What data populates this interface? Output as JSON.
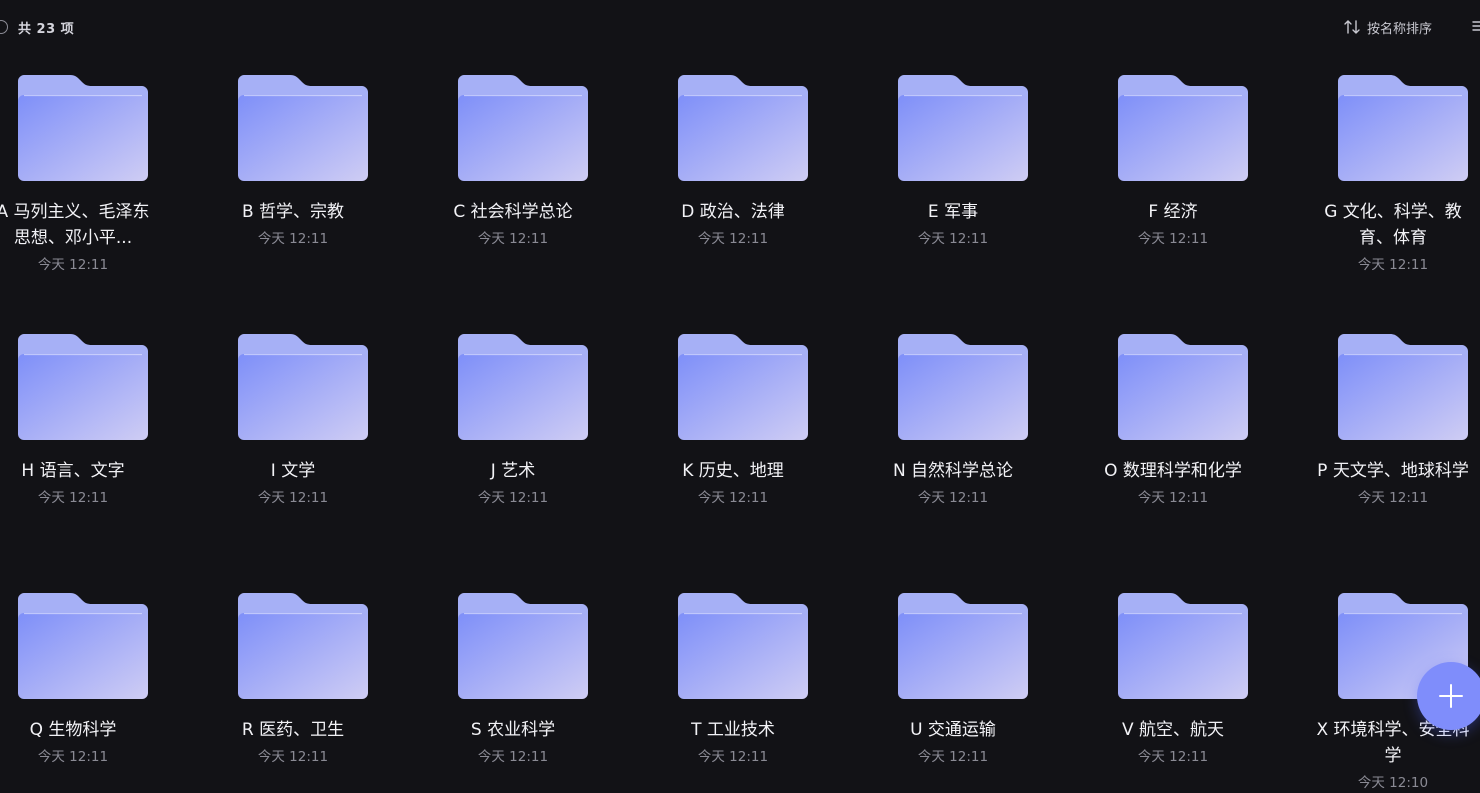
{
  "header": {
    "item_count": "共 23 项",
    "sort_label": "按名称排序",
    "sort_icon": "sort-arrows-icon",
    "menu_icon": "list-view-icon"
  },
  "colors": {
    "background": "#121216",
    "folder_back": "#a6b0f6",
    "folder_front_start": "#7e8ff9",
    "folder_front_end": "#cfcdf4",
    "fab": "#7f8dfb"
  },
  "folders": [
    {
      "name": "A 马列主义、毛泽东思想、邓小平...",
      "time": "今天 12:11"
    },
    {
      "name": "B 哲学、宗教",
      "time": "今天 12:11"
    },
    {
      "name": "C 社会科学总论",
      "time": "今天 12:11"
    },
    {
      "name": "D 政治、法律",
      "time": "今天 12:11"
    },
    {
      "name": "E 军事",
      "time": "今天 12:11"
    },
    {
      "name": "F 经济",
      "time": "今天 12:11"
    },
    {
      "name": "G 文化、科学、教育、体育",
      "time": "今天 12:11"
    },
    {
      "name": "H 语言、文字",
      "time": "今天 12:11"
    },
    {
      "name": "I 文学",
      "time": "今天 12:11"
    },
    {
      "name": "J 艺术",
      "time": "今天 12:11"
    },
    {
      "name": "K 历史、地理",
      "time": "今天 12:11"
    },
    {
      "name": "N 自然科学总论",
      "time": "今天 12:11"
    },
    {
      "name": "O 数理科学和化学",
      "time": "今天 12:11"
    },
    {
      "name": "P 天文学、地球科学",
      "time": "今天 12:11"
    },
    {
      "name": "Q 生物科学",
      "time": "今天 12:11"
    },
    {
      "name": "R 医药、卫生",
      "time": "今天 12:11"
    },
    {
      "name": "S 农业科学",
      "time": "今天 12:11"
    },
    {
      "name": "T 工业技术",
      "time": "今天 12:11"
    },
    {
      "name": "U 交通运输",
      "time": "今天 12:11"
    },
    {
      "name": "V 航空、航天",
      "time": "今天 12:11"
    },
    {
      "name": "X 环境科学、安全科学",
      "time": "今天 12:10"
    }
  ],
  "fab": {
    "icon": "plus-icon"
  }
}
